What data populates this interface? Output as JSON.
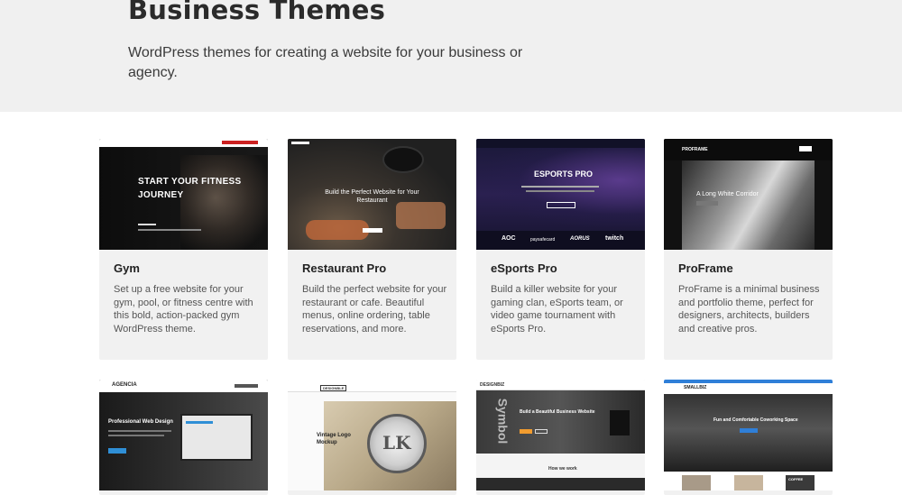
{
  "hero": {
    "title": "Business Themes",
    "description": "WordPress themes for creating a website for your business or agency."
  },
  "themes": [
    {
      "title": "Gym",
      "description": "Set up a free website for your gym, pool, or fitness centre with this bold, action-packed gym WordPress theme.",
      "preview_heading": "START YOUR FITNESS JOURNEY"
    },
    {
      "title": "Restaurant Pro",
      "description": "Build the perfect website for your restaurant or cafe. Beautiful menus, online ordering, table reservations, and more.",
      "preview_heading": "Build the Perfect Website for Your Restaurant"
    },
    {
      "title": "eSports Pro",
      "description": "Build a killer website for your gaming clan, eSports team, or video game tournament with eSports Pro.",
      "preview_heading": "ESPORTS PRO",
      "preview_logos": [
        "AOC",
        "paysafecard",
        "AORUS",
        "twitch"
      ]
    },
    {
      "title": "ProFrame",
      "description": "ProFrame is a minimal business and portfolio theme, perfect for designers, architects, builders and creative pros.",
      "preview_brand": "PROFRAME",
      "preview_heading": "A Long White Corridor"
    },
    {
      "title": "",
      "description": "",
      "preview_brand": "AGENCIA",
      "preview_heading": "Professional Web Design"
    },
    {
      "title": "",
      "description": "",
      "preview_brand": "DESIGNBLE",
      "preview_heading": "Vintage Logo Mockup",
      "preview_badge": "LK"
    },
    {
      "title": "",
      "description": "",
      "preview_brand": "DESIGNBIZ",
      "preview_heading": "Build a Beautiful Business Website",
      "preview_sub": "How we work",
      "preview_side": "Symbol"
    },
    {
      "title": "",
      "description": "",
      "preview_brand": "SMALLBIZ",
      "preview_heading": "Fun and Comfortable Coworking Space",
      "preview_sign": "COFFEE"
    }
  ]
}
